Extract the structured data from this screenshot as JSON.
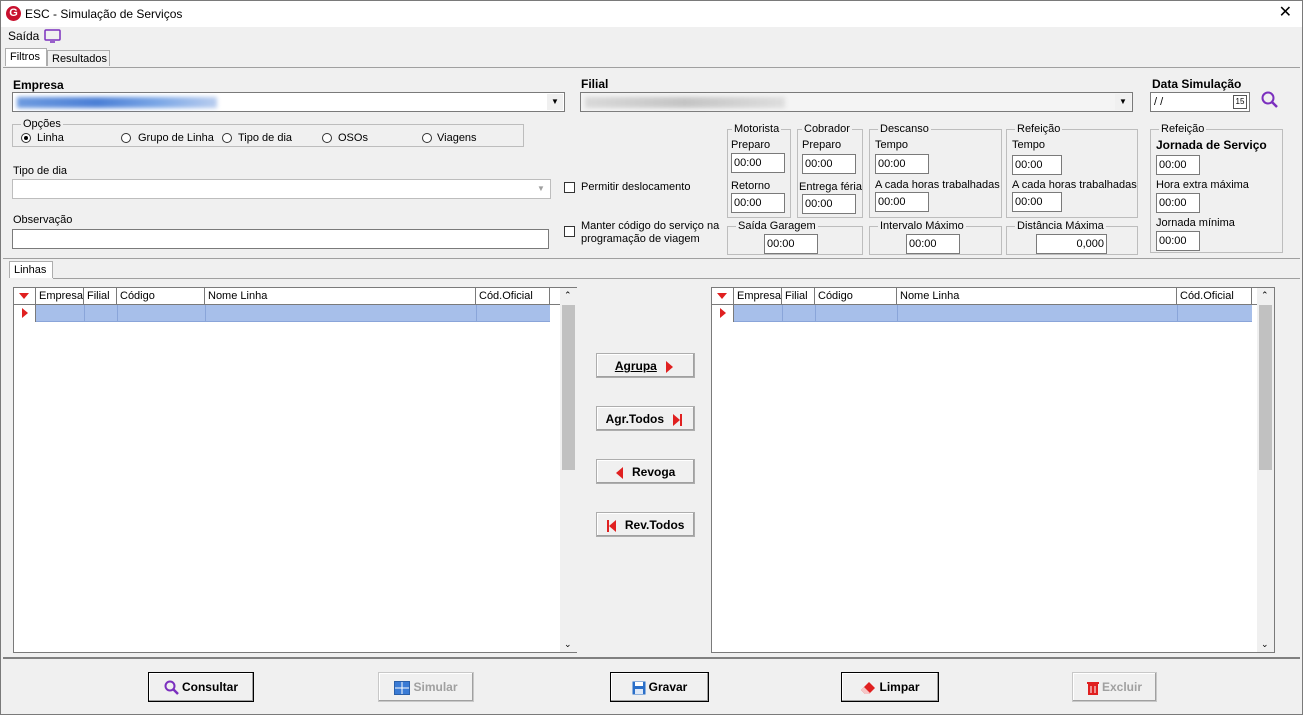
{
  "window": {
    "title": "ESC - Simulação de Serviços",
    "logo_letter": "G",
    "close": "✕"
  },
  "menu": {
    "exit_label": "Saída"
  },
  "tabs": [
    {
      "label": "Filtros"
    },
    {
      "label": "Resultados"
    }
  ],
  "empresa": {
    "label": "Empresa",
    "value": ""
  },
  "filial": {
    "label": "Filial",
    "value": ""
  },
  "data_simulacao": {
    "label": "Data Simulação",
    "value": " / /",
    "calendar": "15"
  },
  "opcoes": {
    "label": "Opções",
    "items": [
      {
        "label": "Linha",
        "selected": true
      },
      {
        "label": "Grupo de Linha",
        "selected": false
      },
      {
        "label": "Tipo de dia",
        "selected": false
      },
      {
        "label": "OSOs",
        "selected": false
      },
      {
        "label": "Viagens",
        "selected": false
      }
    ]
  },
  "tipo_dia": {
    "label": "Tipo de dia",
    "value": ""
  },
  "observacao": {
    "label": "Observação",
    "value": ""
  },
  "permitir_deslocamento": {
    "label": "Permitir deslocamento",
    "checked": false
  },
  "manter_codigo": {
    "label_line1": "Manter código do serviço na",
    "label_line2": "programação de viagem",
    "checked": false
  },
  "motorista": {
    "title": "Motorista",
    "preparo_label": "Preparo",
    "preparo": "00:00",
    "retorno_label": "Retorno",
    "retorno": "00:00"
  },
  "cobrador": {
    "title": "Cobrador",
    "preparo_label": "Preparo",
    "preparo": "00:00",
    "entrega_label": "Entrega féria",
    "entrega": "00:00"
  },
  "descanso": {
    "title": "Descanso",
    "tempo_label": "Tempo",
    "tempo": "00:00",
    "cada_label": "A cada horas trabalhadas",
    "cada": "00:00"
  },
  "refeicao1": {
    "title": "Refeição",
    "tempo_label": "Tempo",
    "tempo": "00:00",
    "cada_label": "A cada horas trabalhadas",
    "cada": "00:00"
  },
  "refeicao2": {
    "title": "Refeição",
    "jornada_label": "Jornada de Serviço",
    "jornada": "00:00",
    "hora_extra_label": "Hora extra máxima",
    "hora_extra": "00:00",
    "jornada_min_label": "Jornada mínima",
    "jornada_min": "00:00"
  },
  "saida_garagem": {
    "title": "Saída Garagem",
    "value": "00:00"
  },
  "intervalo_maximo": {
    "title": "Intervalo Máximo",
    "value": "00:00"
  },
  "distancia_maxima": {
    "title": "Distância Máxima",
    "value": "0,000"
  },
  "linhas_tab": {
    "label": "Linhas"
  },
  "grid_columns": [
    "Empresa",
    "Filial",
    "Código",
    "Nome Linha",
    "Cód.Oficial"
  ],
  "transfer_buttons": {
    "agrupa": "Agrupa",
    "agr_todos": "Agr.Todos",
    "revoga": "Revoga",
    "rev_todos": "Rev.Todos"
  },
  "footer": {
    "consultar": "Consultar",
    "simular": "Simular",
    "gravar": "Gravar",
    "limpar": "Limpar",
    "excluir": "Excluir"
  },
  "colors": {
    "accent": "#7b2fbe",
    "danger": "#e02020",
    "selected_row": "#a7bfea"
  }
}
